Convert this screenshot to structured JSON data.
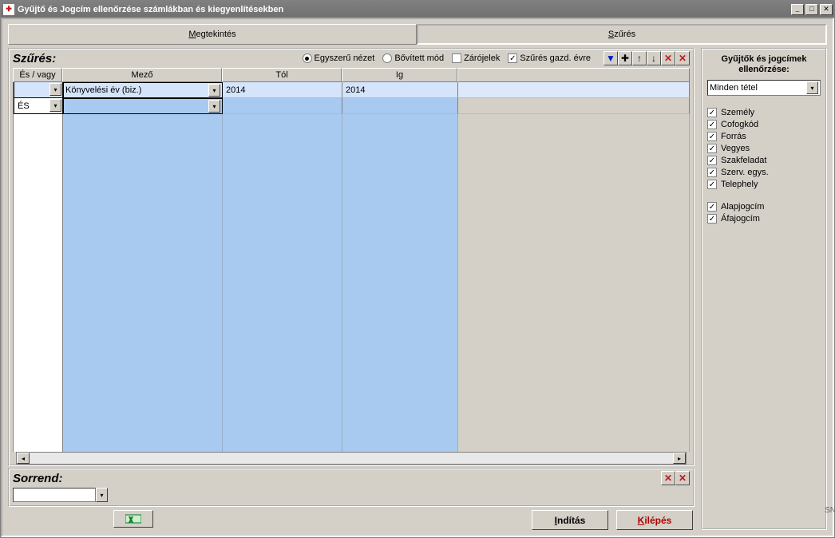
{
  "window": {
    "title": "Gyűjtő és Jogcím ellenőrzése számlákban és kiegyenlítésekben"
  },
  "tabs": {
    "view": "Megtekintés",
    "view_ul": "M",
    "filter": "Szűrés",
    "filter_ul": "S"
  },
  "filter_panel": {
    "title": "Szűrés:",
    "radio_simple": "Egyszerű nézet",
    "radio_advanced": "Bővített mód",
    "chk_paren": "Zárójelek",
    "chk_year": "Szűrés gazd. évre"
  },
  "grid": {
    "headers": {
      "andor": "És / vagy",
      "field": "Mező",
      "from": "Tól",
      "to": "Ig"
    },
    "rows": [
      {
        "andor": "",
        "field": "Könyvelési év (biz.)",
        "from": "2014",
        "to": "2014",
        "selected": true
      },
      {
        "andor": "ÉS",
        "field": "",
        "from": "",
        "to": ""
      }
    ]
  },
  "sorrend": {
    "title": "Sorrend:"
  },
  "right": {
    "title": "Gyűjtők és jogcímek ellenőrzése:",
    "select_value": "Minden tétel",
    "checks_a": [
      "Személy",
      "Cofogkód",
      "Forrás",
      "Vegyes",
      "Szakfeladat",
      "Szerv. egys.",
      "Telephely"
    ],
    "checks_b": [
      "Alapjogcím",
      "Áfajogcím"
    ]
  },
  "buttons": {
    "start": "Indítás",
    "start_ul": "I",
    "exit": "Kilépés",
    "exit_ul": "K"
  },
  "corner": "SN"
}
